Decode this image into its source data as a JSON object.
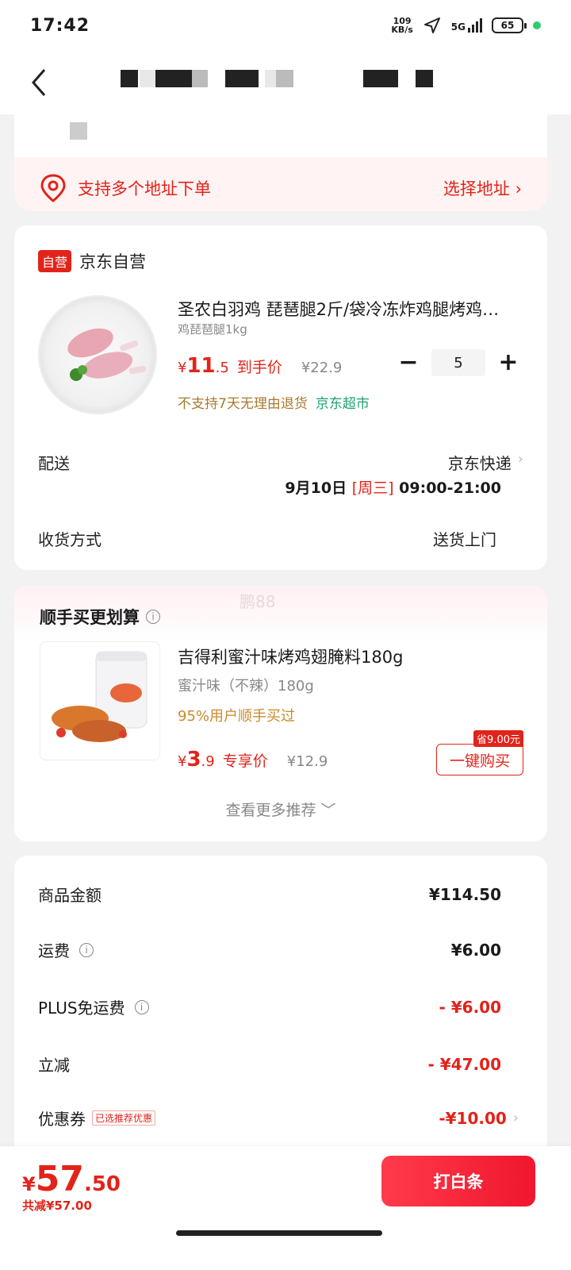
{
  "status_bar": {
    "time": "17:42",
    "speed_value": "109",
    "speed_unit": "KB/s",
    "network": "5G",
    "battery": "65"
  },
  "address": {
    "multi_address_text": "支持多个地址下单",
    "select_label": "选择地址 ›"
  },
  "product": {
    "shop_badge": "自营",
    "shop_name": "京东自营",
    "title": "圣农白羽鸡 琵琶腿2斤/袋冷冻炸鸡腿烤鸡…",
    "spec": "鸡琵琶腿1kg",
    "price_currency": "¥",
    "price_int": "11",
    "price_dec": ".5",
    "price_tag": "到手价",
    "orig_price": "¥22.9",
    "quantity": "5",
    "minus": "−",
    "plus": "+",
    "notice": "不支持7天无理由退货",
    "store_tag": "京东超市"
  },
  "delivery": {
    "label": "配送",
    "method": "京东快递",
    "date": "9月10日",
    "weekday": "[周三]",
    "window": "09:00-21:00",
    "receive_label": "收货方式",
    "receive_value": "送货上门"
  },
  "recommend": {
    "title": "顺手买更划算",
    "watermark": "鹏88",
    "name": "吉得利蜜汁味烤鸡翅腌料180g",
    "spec": "蜜汁味（不辣）180g",
    "bought": "95%用户顺手买过",
    "price_currency": "¥",
    "price_int": "3",
    "price_dec": ".9",
    "price_tag": "专享价",
    "orig_price": "¥12.9",
    "save_tag": "省9.00元",
    "buy_label": "一键购买",
    "more": "查看更多推荐 ﹀"
  },
  "summary": {
    "goods_label": "商品金额",
    "goods_amount": "¥114.50",
    "shipping_label": "运费",
    "shipping_amount": "¥6.00",
    "plus_label": "PLUS免运费",
    "plus_amount": "- ¥6.00",
    "discount_label": "立减",
    "discount_amount": "- ¥47.00",
    "coupon_label": "优惠券",
    "coupon_tag": "已选推荐优惠",
    "coupon_amount": "-¥10.00"
  },
  "bottom": {
    "currency": "¥",
    "total_int": "57",
    "total_dec": ".50",
    "saved": "共减¥57.00",
    "pay_label": "打白条"
  },
  "colors": {
    "accent": "#e2231a",
    "green": "#1ca36e",
    "notice": "#a87a2c"
  },
  "icons": [
    "back-icon",
    "location-pin-icon",
    "info-icon",
    "chevron-right-icon",
    "chevron-down-icon",
    "navigation-arrow-icon",
    "signal-icon",
    "battery-icon"
  ]
}
